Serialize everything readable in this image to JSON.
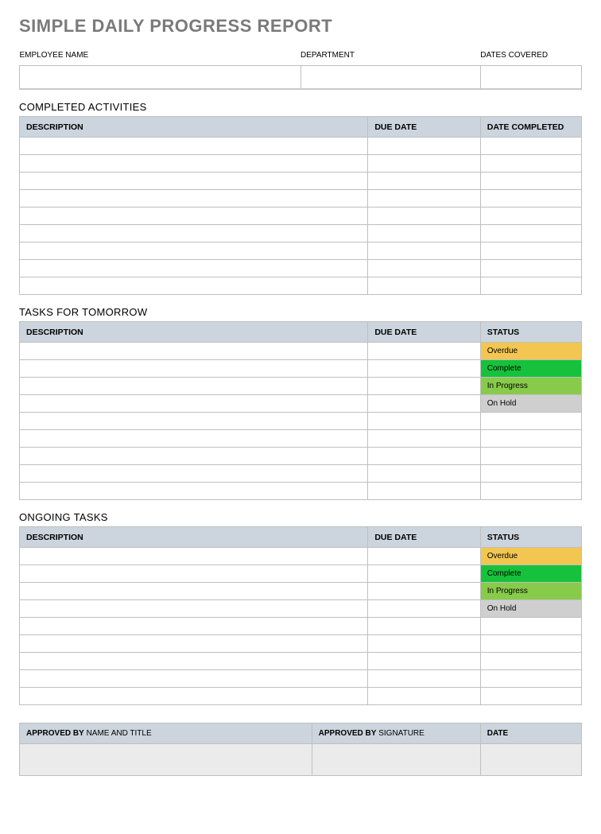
{
  "title": "SIMPLE DAILY PROGRESS REPORT",
  "info": {
    "employee_name_label": "EMPLOYEE NAME",
    "department_label": "DEPARTMENT",
    "dates_covered_label": "DATES COVERED",
    "employee_name": "",
    "department": "",
    "dates_covered": ""
  },
  "completed": {
    "title": "COMPLETED ACTIVITIES",
    "headers": {
      "description": "DESCRIPTION",
      "due": "DUE DATE",
      "completed": "DATE COMPLETED"
    },
    "rows": [
      {
        "description": "",
        "due": "",
        "completed": ""
      },
      {
        "description": "",
        "due": "",
        "completed": ""
      },
      {
        "description": "",
        "due": "",
        "completed": ""
      },
      {
        "description": "",
        "due": "",
        "completed": ""
      },
      {
        "description": "",
        "due": "",
        "completed": ""
      },
      {
        "description": "",
        "due": "",
        "completed": ""
      },
      {
        "description": "",
        "due": "",
        "completed": ""
      },
      {
        "description": "",
        "due": "",
        "completed": ""
      },
      {
        "description": "",
        "due": "",
        "completed": ""
      }
    ]
  },
  "tomorrow": {
    "title": "TASKS FOR TOMORROW",
    "headers": {
      "description": "DESCRIPTION",
      "due": "DUE DATE",
      "status": "STATUS"
    },
    "rows": [
      {
        "description": "",
        "due": "",
        "status": "Overdue",
        "status_class": "status-overdue"
      },
      {
        "description": "",
        "due": "",
        "status": "Complete",
        "status_class": "status-complete"
      },
      {
        "description": "",
        "due": "",
        "status": "In Progress",
        "status_class": "status-inprogress"
      },
      {
        "description": "",
        "due": "",
        "status": "On Hold",
        "status_class": "status-onhold"
      },
      {
        "description": "",
        "due": "",
        "status": "",
        "status_class": ""
      },
      {
        "description": "",
        "due": "",
        "status": "",
        "status_class": ""
      },
      {
        "description": "",
        "due": "",
        "status": "",
        "status_class": ""
      },
      {
        "description": "",
        "due": "",
        "status": "",
        "status_class": ""
      },
      {
        "description": "",
        "due": "",
        "status": "",
        "status_class": ""
      }
    ]
  },
  "ongoing": {
    "title": "ONGOING TASKS",
    "headers": {
      "description": "DESCRIPTION",
      "due": "DUE DATE",
      "status": "STATUS"
    },
    "rows": [
      {
        "description": "",
        "due": "",
        "status": "Overdue",
        "status_class": "status-overdue"
      },
      {
        "description": "",
        "due": "",
        "status": "Complete",
        "status_class": "status-complete"
      },
      {
        "description": "",
        "due": "",
        "status": "In Progress",
        "status_class": "status-inprogress"
      },
      {
        "description": "",
        "due": "",
        "status": "On Hold",
        "status_class": "status-onhold"
      },
      {
        "description": "",
        "due": "",
        "status": "",
        "status_class": ""
      },
      {
        "description": "",
        "due": "",
        "status": "",
        "status_class": ""
      },
      {
        "description": "",
        "due": "",
        "status": "",
        "status_class": ""
      },
      {
        "description": "",
        "due": "",
        "status": "",
        "status_class": ""
      },
      {
        "description": "",
        "due": "",
        "status": "",
        "status_class": ""
      }
    ]
  },
  "approval": {
    "approved_by_bold": "APPROVED BY",
    "name_title_suffix": " NAME AND TITLE",
    "signature_suffix": " SIGNATURE",
    "date_label": "DATE",
    "name_title": "",
    "signature": "",
    "date": ""
  }
}
